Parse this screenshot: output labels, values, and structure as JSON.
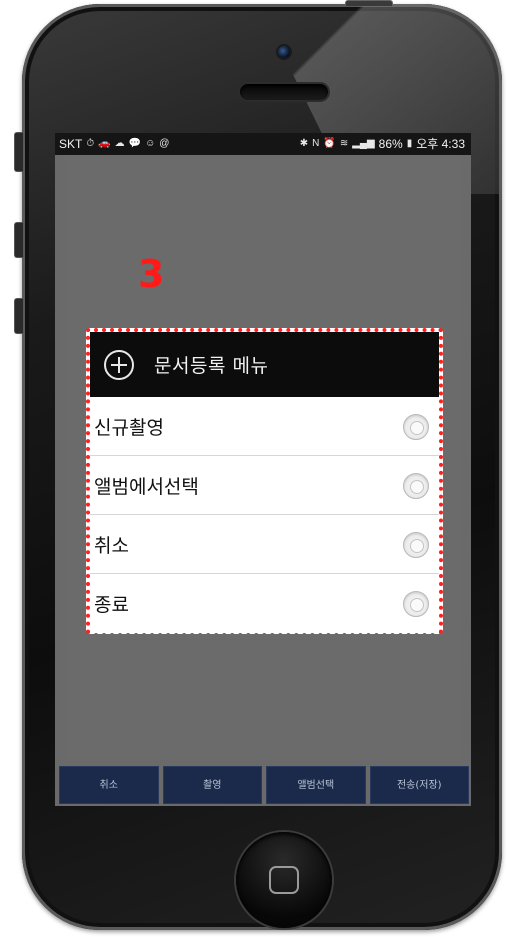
{
  "status_bar": {
    "carrier": "SKT",
    "battery": "86%",
    "time": "오후 4:33",
    "left_icons": [
      "alarm-icon",
      "car-icon",
      "cloud-icon",
      "chat-icon",
      "cat-icon",
      "mail-icon"
    ],
    "right_icons": [
      "bluetooth-icon",
      "nfc-icon",
      "alarm-clock-icon",
      "wifi-icon",
      "signal-icon",
      "battery-icon"
    ]
  },
  "annotation": {
    "step_number": "3",
    "highlight_color": "#ff2020"
  },
  "dialog": {
    "title": "문서등록 메뉴",
    "icon": "plus-circle-icon",
    "items": [
      {
        "label": "신규촬영"
      },
      {
        "label": "앨범에서선택"
      },
      {
        "label": "취소"
      },
      {
        "label": "종료"
      }
    ]
  },
  "bottom_bar": {
    "buttons": [
      {
        "label": "취소"
      },
      {
        "label": "촬영"
      },
      {
        "label": "앨범선택"
      },
      {
        "label": "전송(저장)"
      }
    ]
  },
  "colors": {
    "screen_overlay": "#6a6a6a",
    "dialog_header": "#0c0c0c",
    "button_bar": "#1b2a4a"
  }
}
